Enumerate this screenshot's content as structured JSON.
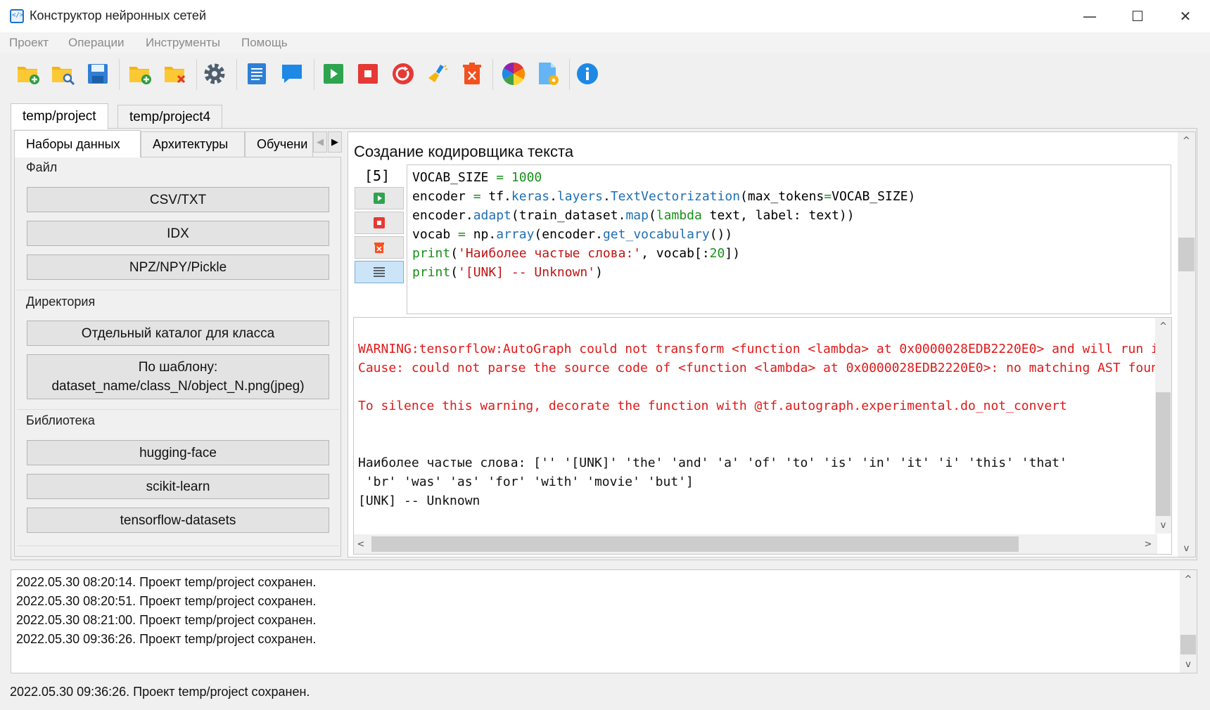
{
  "window": {
    "title": "Конструктор нейронных сетей",
    "controls": {
      "minimize": "—",
      "maximize": "☐",
      "close": "✕"
    }
  },
  "menu": [
    "Проект",
    "Операции",
    "Инструменты",
    "Помощь"
  ],
  "toolbar": {
    "icons": [
      "new-project-icon",
      "open-project-icon",
      "save-icon",
      "add-folder-icon",
      "remove-folder-icon",
      "settings-icon",
      "document-icon",
      "comment-icon",
      "run-icon",
      "stop-icon",
      "restart-icon",
      "clear-icon",
      "delete-icon",
      "color-icon",
      "file-settings-icon",
      "info-icon"
    ]
  },
  "project_tabs": [
    "temp/project",
    "temp/project4"
  ],
  "left_panel": {
    "tabs": [
      "Наборы данных",
      "Архитектуры",
      "Обучени"
    ],
    "groups": {
      "file": {
        "title": "Файл",
        "buttons": [
          "CSV/TXT",
          "IDX",
          "NPZ/NPY/Pickle"
        ]
      },
      "directory": {
        "title": "Директория",
        "buttons": [
          "Отдельный каталог для класса",
          "По шаблону:\ndataset_name/class_N/object_N.png(jpeg)"
        ]
      },
      "library": {
        "title": "Библиотека",
        "buttons": [
          "hugging-face",
          "scikit-learn",
          "tensorflow-datasets"
        ]
      }
    }
  },
  "cell": {
    "title": "Создание кодировщика текста",
    "number": "[5]",
    "code": [
      "VOCAB_SIZE = 1000",
      "encoder = tf.keras.layers.TextVectorization(max_tokens=VOCAB_SIZE)",
      "encoder.adapt(train_dataset.map(lambda text, label: text))",
      "vocab = np.array(encoder.get_vocabulary())",
      "print('Наиболее частые слова:', vocab[:20])",
      "print('[UNK] -- Unknown')"
    ],
    "output": [
      "WARNING:tensorflow:AutoGraph could not transform <function <lambda> at 0x0000028EDB2220E0> and will run it",
      "Cause: could not parse the source code of <function <lambda> at 0x0000028EDB2220E0>: no matching AST found",
      "To silence this warning, decorate the function with @tf.autograph.experimental.do_not_convert",
      "Наиболее частые слова: ['' '[UNK]' 'the' 'and' 'a' 'of' 'to' 'is' 'in' 'it' 'i' 'this' 'that'",
      " 'br' 'was' 'as' 'for' 'with' 'movie' 'but']",
      "[UNK] -- Unknown"
    ]
  },
  "log": [
    "2022.05.30 08:20:14. Проект temp/project сохранен.",
    "2022.05.30 08:20:51. Проект temp/project сохранен.",
    "2022.05.30 08:21:00. Проект temp/project сохранен.",
    "2022.05.30 09:36:26. Проект temp/project сохранен."
  ],
  "status": "2022.05.30 09:36:26. Проект temp/project сохранен."
}
